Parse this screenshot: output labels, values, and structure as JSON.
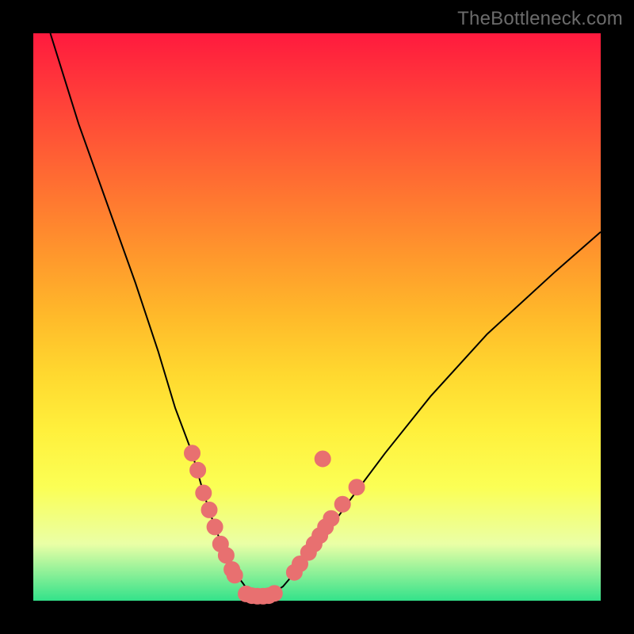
{
  "watermark": "TheBottleneck.com",
  "colors": {
    "dot": "#e87070",
    "curve": "#000000",
    "frame": "#000000"
  },
  "chart_data": {
    "type": "line",
    "title": "",
    "xlabel": "",
    "ylabel": "",
    "xlim": [
      0,
      100
    ],
    "ylim": [
      0,
      100
    ],
    "legend": false,
    "grid": false,
    "series": [
      {
        "name": "bottleneck-curve",
        "x": [
          3,
          8,
          13,
          18,
          22,
          25,
          28,
          30,
          32,
          34,
          35.5,
          37,
          38,
          39,
          40,
          41,
          42,
          44,
          47,
          51,
          56,
          62,
          70,
          80,
          92,
          100
        ],
        "y": [
          100,
          84,
          70,
          56,
          44,
          34,
          26,
          19,
          13,
          8,
          5,
          3,
          1.5,
          0.8,
          0.8,
          0.8,
          1.2,
          2.5,
          6,
          11,
          18,
          26,
          36,
          47,
          58,
          65
        ]
      }
    ],
    "points": [
      {
        "name": "cluster-left",
        "x": 28,
        "y": 26
      },
      {
        "name": "cluster-left",
        "x": 29,
        "y": 23
      },
      {
        "name": "cluster-left",
        "x": 30,
        "y": 19
      },
      {
        "name": "cluster-left",
        "x": 31,
        "y": 16
      },
      {
        "name": "cluster-left",
        "x": 32,
        "y": 13
      },
      {
        "name": "cluster-left",
        "x": 33,
        "y": 10
      },
      {
        "name": "cluster-left",
        "x": 34,
        "y": 8
      },
      {
        "name": "cluster-left",
        "x": 35,
        "y": 5.5
      },
      {
        "name": "cluster-left",
        "x": 35.5,
        "y": 4.5
      },
      {
        "name": "valley",
        "x": 37.5,
        "y": 1.2
      },
      {
        "name": "valley",
        "x": 38.5,
        "y": 0.9
      },
      {
        "name": "valley",
        "x": 39.5,
        "y": 0.8
      },
      {
        "name": "valley",
        "x": 40.5,
        "y": 0.8
      },
      {
        "name": "valley",
        "x": 41.5,
        "y": 0.9
      },
      {
        "name": "valley",
        "x": 42.5,
        "y": 1.3
      },
      {
        "name": "cluster-right",
        "x": 46,
        "y": 5
      },
      {
        "name": "cluster-right",
        "x": 47,
        "y": 6.5
      },
      {
        "name": "cluster-right",
        "x": 48.5,
        "y": 8.5
      },
      {
        "name": "cluster-right",
        "x": 49.5,
        "y": 10
      },
      {
        "name": "cluster-right",
        "x": 50.5,
        "y": 11.5
      },
      {
        "name": "cluster-right",
        "x": 51.5,
        "y": 13
      },
      {
        "name": "cluster-right",
        "x": 52.5,
        "y": 14.5
      },
      {
        "name": "cluster-right",
        "x": 54.5,
        "y": 17
      },
      {
        "name": "cluster-right",
        "x": 57,
        "y": 20
      },
      {
        "name": "outlier-right",
        "x": 51,
        "y": 25
      }
    ]
  }
}
